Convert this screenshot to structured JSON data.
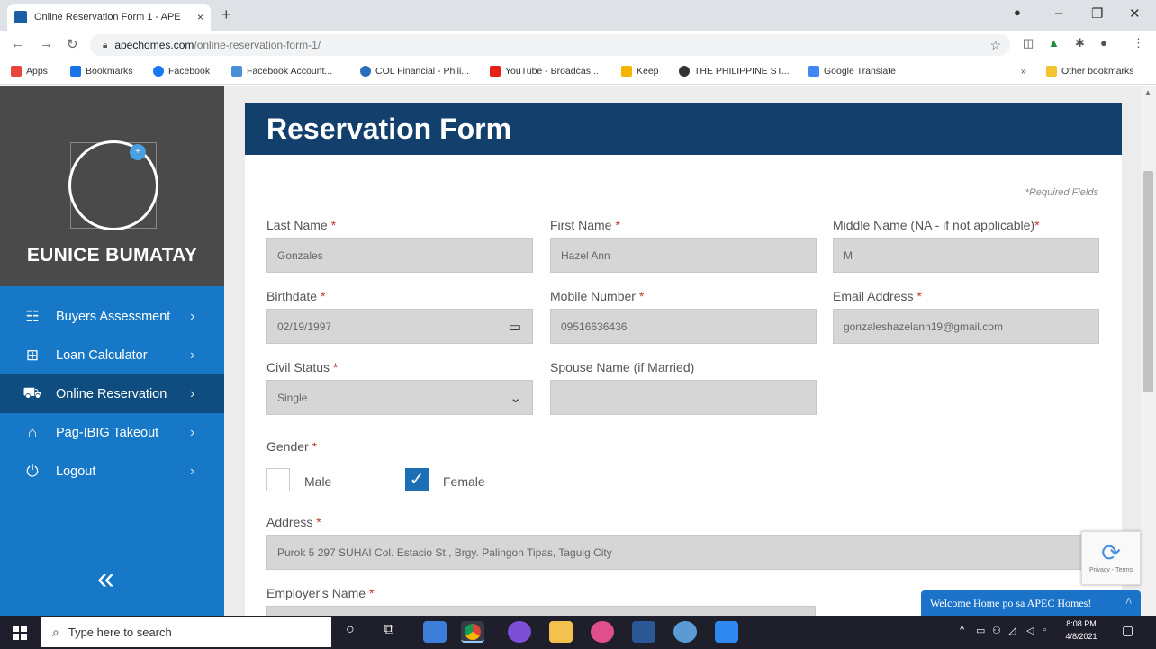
{
  "browser": {
    "tab_title": "Online Reservation Form 1 - APE",
    "tab_close": "×",
    "new_tab": "+",
    "url_domain": "apechomes.com",
    "url_path": "/online-reservation-form-1/",
    "window_controls": [
      "–",
      "❐",
      "✕"
    ],
    "bookmarks": [
      {
        "label": "Apps",
        "color": "#e8453c"
      },
      {
        "label": "Bookmarks",
        "color": "#1a73e8"
      },
      {
        "label": "Facebook",
        "color": "#1877f2"
      },
      {
        "label": "Facebook Account...",
        "color": "#4a90d9"
      },
      {
        "label": "COL Financial - Phili...",
        "color": "#2a6ebb"
      },
      {
        "label": "YouTube - Broadcas...",
        "color": "#e62117"
      },
      {
        "label": "Keep",
        "color": "#f4b400"
      },
      {
        "label": "THE PHILIPPINE ST...",
        "color": "#333333"
      },
      {
        "label": "Google Translate",
        "color": "#4285f4"
      }
    ],
    "overflow": "»",
    "other_bookmarks": "Other bookmarks"
  },
  "sidebar": {
    "username": "EUNICE BUMATAY",
    "avatar_badge": "+",
    "items": [
      {
        "label": "Buyers Assessment",
        "icon": "users-icon",
        "glyph": "☷",
        "active": false
      },
      {
        "label": "Loan Calculator",
        "icon": "calculator-icon",
        "glyph": "⊞",
        "active": false
      },
      {
        "label": "Online Reservation",
        "icon": "cart-icon",
        "glyph": "⛟",
        "active": true
      },
      {
        "label": "Pag-IBIG Takeout",
        "icon": "house-icon",
        "glyph": "⌂",
        "active": false
      },
      {
        "label": "Logout",
        "icon": "power-icon",
        "glyph": "⏻",
        "active": false
      }
    ],
    "chevron": "›",
    "collapse_glyph": "«"
  },
  "form": {
    "title": "Reservation Form",
    "required_note": "*Required Fields",
    "required_star": "*",
    "last_name": {
      "label": "Last Name",
      "value": "Gonzales"
    },
    "first_name": {
      "label": "First Name",
      "value": "Hazel Ann"
    },
    "middle_name": {
      "label": "Middle Name (NA - if not applicable)",
      "value": "M"
    },
    "birthdate": {
      "label": "Birthdate",
      "value": "02/19/1997"
    },
    "mobile": {
      "label": "Mobile Number",
      "value": "09516636436"
    },
    "email": {
      "label": "Email Address",
      "value": "gonzaleshazelann19@gmail.com"
    },
    "civil_status": {
      "label": "Civil Status",
      "value": "Single"
    },
    "spouse": {
      "label": "Spouse Name (if Married)",
      "value": ""
    },
    "gender": {
      "label": "Gender",
      "options": [
        "Male",
        "Female"
      ],
      "selected": "Female"
    },
    "address": {
      "label": "Address",
      "value": "Purok 5 297 SUHAI Col. Estacio St., Brgy. Palingon Tipas, Taguig City"
    },
    "employer": {
      "label": "Employer's Name",
      "value": ""
    }
  },
  "recaptcha": {
    "text": "Privacy - Terms"
  },
  "chat": {
    "text": "Welcome Home po sa APEC Homes!",
    "caret": "^"
  },
  "taskbar": {
    "search_placeholder": "Type here to search",
    "time": "8:08 PM",
    "date": "4/8/2021"
  }
}
